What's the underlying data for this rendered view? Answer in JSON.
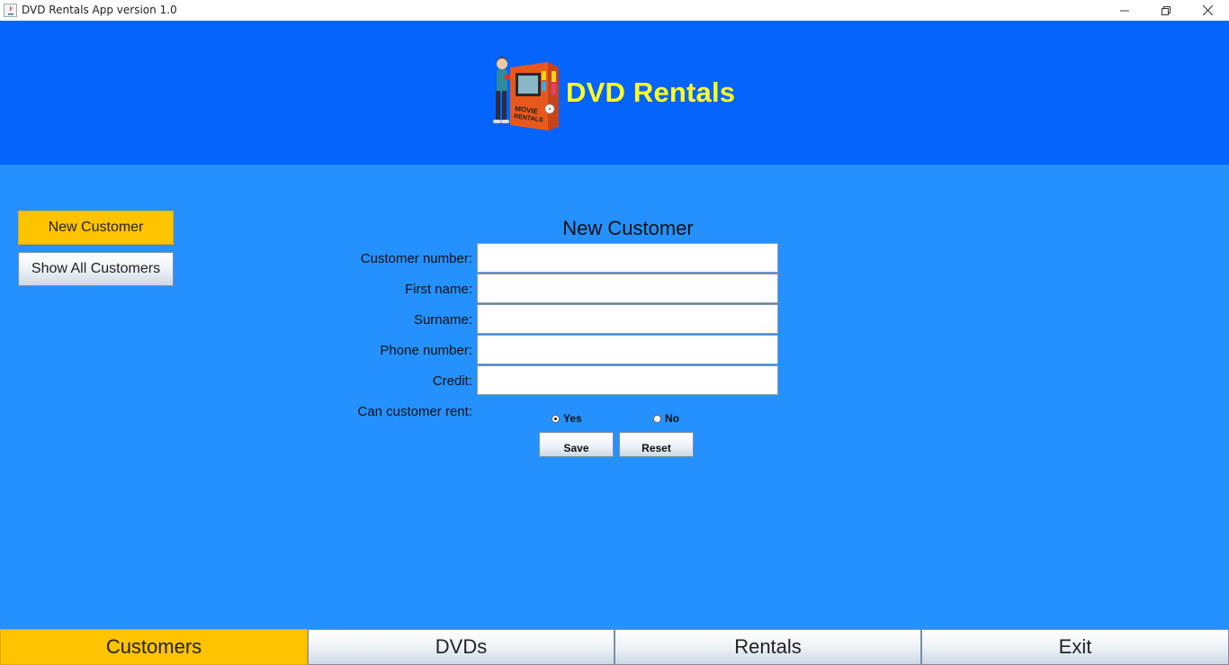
{
  "window": {
    "title": "DVD Rentals App version 1.0",
    "controls": [
      "minimize-icon",
      "restore-icon",
      "close-icon"
    ]
  },
  "header": {
    "title": "DVD Rentals",
    "logo_icon": "movie-rentals-kiosk-icon",
    "logo_text": "MOVIE RENTALS",
    "colors": {
      "background": "#0464fb",
      "title": "#ffff1e"
    }
  },
  "sidebar": {
    "items": [
      {
        "label": "New Customer",
        "active": true
      },
      {
        "label": "Show All Customers",
        "active": false
      }
    ]
  },
  "form": {
    "title": "New Customer",
    "fields": [
      {
        "label": "Customer number:",
        "value": ""
      },
      {
        "label": "First name:",
        "value": ""
      },
      {
        "label": "Surname:",
        "value": ""
      },
      {
        "label": "Phone number:",
        "value": ""
      },
      {
        "label": "Credit:",
        "value": ""
      }
    ],
    "can_rent": {
      "label": "Can customer rent:",
      "options": [
        {
          "label": "Yes",
          "selected": true
        },
        {
          "label": "No",
          "selected": false
        }
      ]
    },
    "buttons": {
      "save": "Save",
      "reset": "Reset"
    }
  },
  "tabs": [
    {
      "label": "Customers",
      "active": true
    },
    {
      "label": "DVDs",
      "active": false
    },
    {
      "label": "Rentals",
      "active": false
    },
    {
      "label": "Exit",
      "active": false
    }
  ],
  "colors": {
    "page_background": "#2491ff",
    "accent_active": "#ffc300"
  }
}
